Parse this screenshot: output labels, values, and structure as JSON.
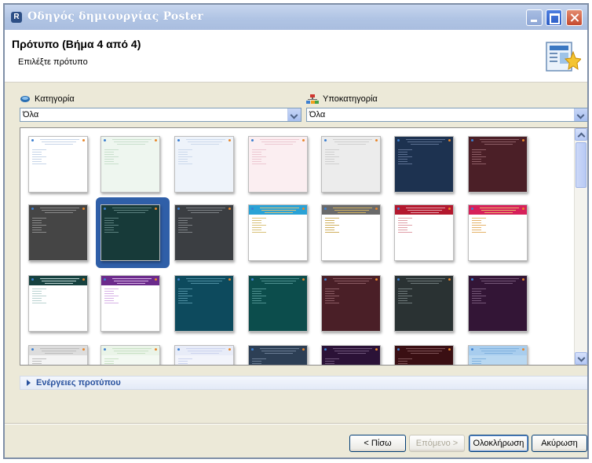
{
  "window": {
    "title": "Οδηγός δημιουργίας Poster",
    "icon": "app-icon"
  },
  "header": {
    "title": "Πρότυπο (Βήμα 4 από 4)",
    "subtitle": "Επιλέξτε πρότυπο",
    "icon": "wizard-template-icon"
  },
  "category": {
    "label": "Κατηγορία",
    "value": "Όλα",
    "icon": "category-icon"
  },
  "subcategory": {
    "label": "Υποκατηγορία",
    "value": "Όλα",
    "icon": "subcategory-icon"
  },
  "templates": [
    {
      "bg": "#ffffff",
      "bar": "#ffffff",
      "ink": "#c7d5e8"
    },
    {
      "bg": "#eef6ef",
      "bar": "#eef6ef",
      "ink": "#c9dfcd"
    },
    {
      "bg": "#eef3fa",
      "bar": "#eef3fa",
      "ink": "#ccd9ec"
    },
    {
      "bg": "#fbeef1",
      "bar": "#fbeef1",
      "ink": "#ecc8d2"
    },
    {
      "bg": "#ececec",
      "bar": "#ececec",
      "ink": "#cfcfcf"
    },
    {
      "bg": "#1d3250",
      "bar": "#1d3250",
      "ink": "#5d7192"
    },
    {
      "bg": "#4b1f27",
      "bar": "#4b1f27",
      "ink": "#8d5e66"
    },
    {
      "bg": "#454545",
      "bar": "#454545",
      "ink": "#8a8a8a"
    },
    {
      "bg": "#173a39",
      "bar": "#173a39",
      "ink": "#5a7f7d"
    },
    {
      "bg": "#3b3e42",
      "bar": "#3b3e42",
      "ink": "#7d8185"
    },
    {
      "bg": "#ffffff",
      "bar": "#2aa2d6",
      "ink": "#d9c27a"
    },
    {
      "bg": "#ffffff",
      "bar": "#6a6a6a",
      "ink": "#d0b060"
    },
    {
      "bg": "#ffffff",
      "bar": "#b3182e",
      "ink": "#e0a0a8"
    },
    {
      "bg": "#ffffff",
      "bar": "#d6205a",
      "ink": "#e5b36b"
    },
    {
      "bg": "#ffffff",
      "bar": "#16413f",
      "ink": "#bbd3d1"
    },
    {
      "bg": "#ffffff",
      "bar": "#6b2a8b",
      "ink": "#d7b3e6"
    },
    {
      "bg": "#0d4a5d",
      "bar": "#0d4a5d",
      "ink": "#4f8fa2"
    },
    {
      "bg": "#0c4d4c",
      "bar": "#0c4d4c",
      "ink": "#4f9190"
    },
    {
      "bg": "#4a1f27",
      "bar": "#4a1f27",
      "ink": "#8b5c64"
    },
    {
      "bg": "#2a3233",
      "bar": "#2a3233",
      "ink": "#6f7a7b"
    },
    {
      "bg": "#331536",
      "bar": "#331536",
      "ink": "#765879"
    },
    {
      "bg": "#f4f4f4",
      "bar": "#dddddd",
      "ink": "#bcbcbc"
    },
    {
      "bg": "#f3f9f2",
      "bar": "#eaf4e8",
      "ink": "#c8e0c4"
    },
    {
      "bg": "#f2f4fb",
      "bar": "#e8ecf8",
      "ink": "#cbd3ee"
    },
    {
      "bg": "#2d3f55",
      "bar": "#2d3f55",
      "ink": "#6b7d94"
    },
    {
      "bg": "#2b1237",
      "bar": "#2b1237",
      "ink": "#6e557a"
    },
    {
      "bg": "#3a0f13",
      "bar": "#3a0f13",
      "ink": "#7d5256"
    },
    {
      "bg": "#b9d8f1",
      "bar": "#a8cdee",
      "ink": "#7fb1de"
    }
  ],
  "selected_template_index": 8,
  "template_actions": {
    "label": "Ενέργειες προτύπου"
  },
  "buttons": {
    "back": "< Πίσω",
    "next": "Επόμενο >",
    "finish": "Ολοκλήρωση",
    "cancel": "Ακύρωση"
  }
}
